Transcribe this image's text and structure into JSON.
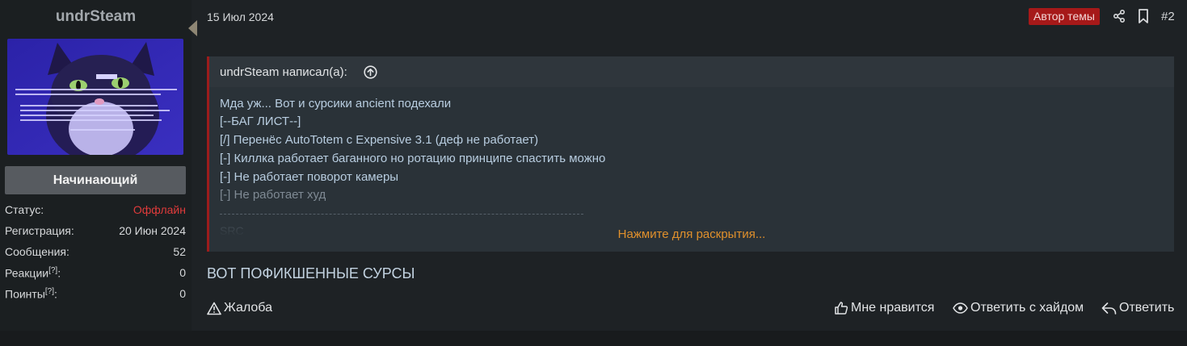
{
  "user": {
    "name": "undrSteam",
    "rank": "Начинающий",
    "stats": [
      {
        "label": "Статус:",
        "value": "Оффлайн",
        "help": ""
      },
      {
        "label": "Регистрация:",
        "value": "20 Июн 2024",
        "help": ""
      },
      {
        "label": "Сообщения:",
        "value": "52",
        "help": ""
      },
      {
        "label": "Реакции",
        "value": "0",
        "help": "[?]"
      },
      {
        "label": "Поинты",
        "value": "0",
        "help": "[?]"
      }
    ],
    "colon": ":"
  },
  "post": {
    "date": "15 Июл 2024",
    "author_badge": "Автор темы",
    "number": "#2",
    "body": "ВОТ ПОФИКШЕННЫЕ СУРСЫ"
  },
  "quote": {
    "author": "undrSteam написал(а):",
    "lines": [
      "Мда уж... Вот и сурсики ancient подехали",
      "[--БАГ ЛИСТ--]",
      "[/] Перенёс AutoTotem с Expensive 3.1 (деф не работает)",
      "[-] Киллка работает баганного но ротацию принципе спастить можно",
      "[-] Не работает поворот камеры",
      "[-] Не работает худ"
    ],
    "src": "SRC",
    "expand": "Нажмите для раскрытия..."
  },
  "actions": {
    "report": "Жалоба",
    "like": "Мне нравится",
    "reply_hide": "Ответить с хайдом",
    "reply": "Ответить"
  },
  "icons": [
    "share-icon",
    "bookmark-icon",
    "arrow-up-circle-icon",
    "warning-icon",
    "thumbs-up-icon",
    "eye-icon",
    "reply-icon"
  ],
  "colors": {
    "background": "#1e2225",
    "quote_bg": "#2a3238",
    "quote_border": "#9c1c1c",
    "author_badge": "#a61919",
    "offline": "#e03b3b",
    "expand_link": "#e0902c"
  }
}
